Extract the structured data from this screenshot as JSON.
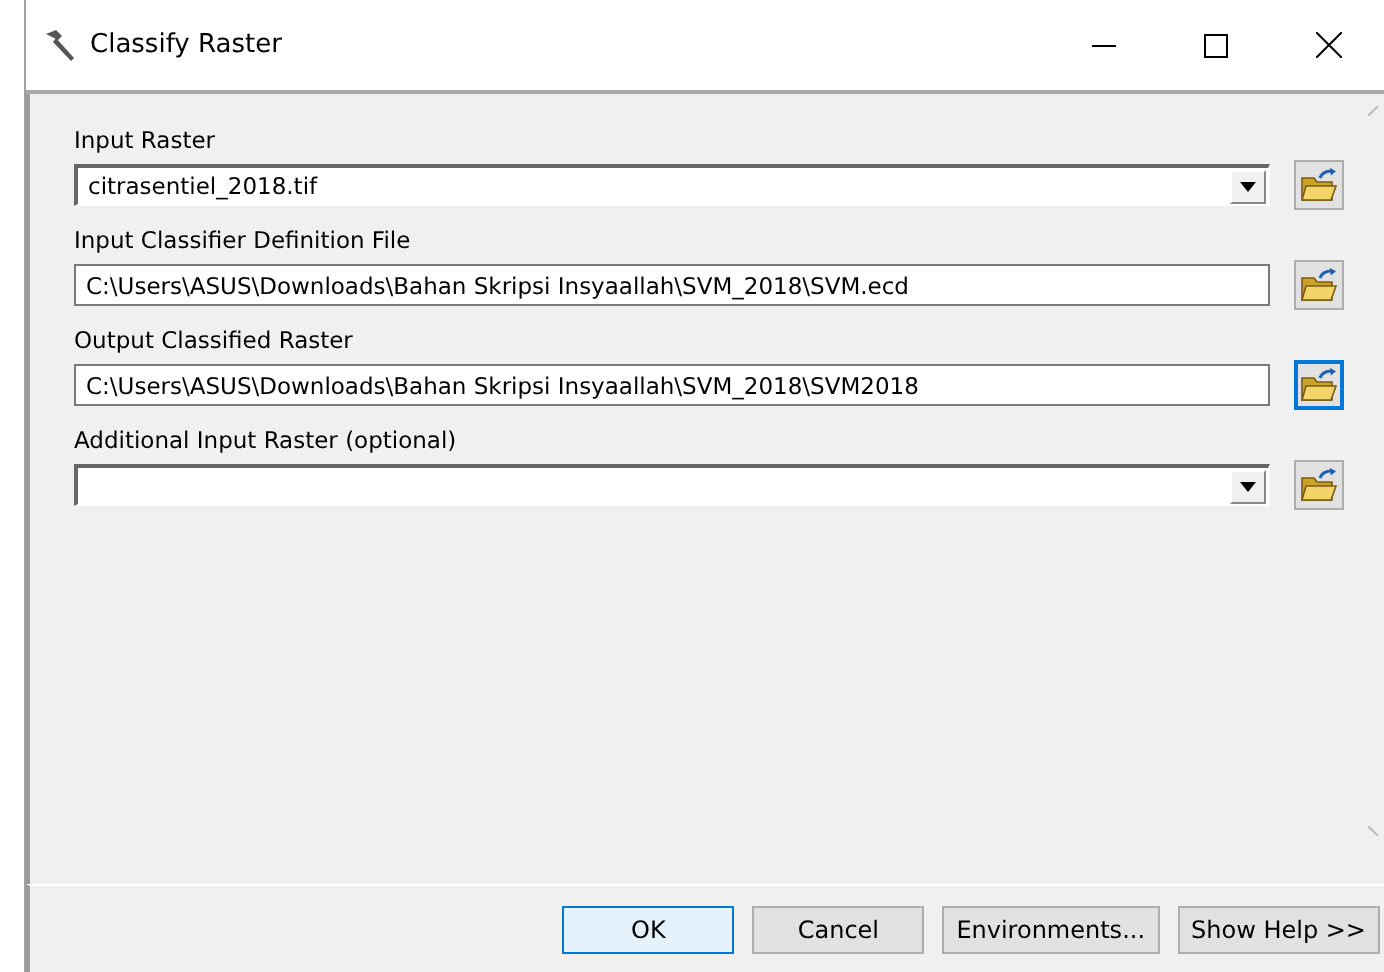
{
  "window": {
    "title": "Classify Raster"
  },
  "fields": [
    {
      "label": "Input Raster",
      "kind": "combo",
      "value": "citrasentiel_2018.tif",
      "focused": false
    },
    {
      "label": "Input Classifier Definition File",
      "kind": "text",
      "value": "C:\\Users\\ASUS\\Downloads\\Bahan Skripsi Insyaallah\\SVM_2018\\SVM.ecd",
      "focused": false
    },
    {
      "label": "Output Classified Raster",
      "kind": "text",
      "value": "C:\\Users\\ASUS\\Downloads\\Bahan Skripsi Insyaallah\\SVM_2018\\SVM2018",
      "focused": true
    },
    {
      "label": "Additional Input Raster (optional)",
      "kind": "combo",
      "focused": false
    }
  ],
  "buttons": [
    {
      "label": "OK",
      "default": true
    },
    {
      "label": "Cancel",
      "default": false
    },
    {
      "label": "Environments...",
      "default": false
    },
    {
      "label": "Show Help >>",
      "default": false
    }
  ]
}
